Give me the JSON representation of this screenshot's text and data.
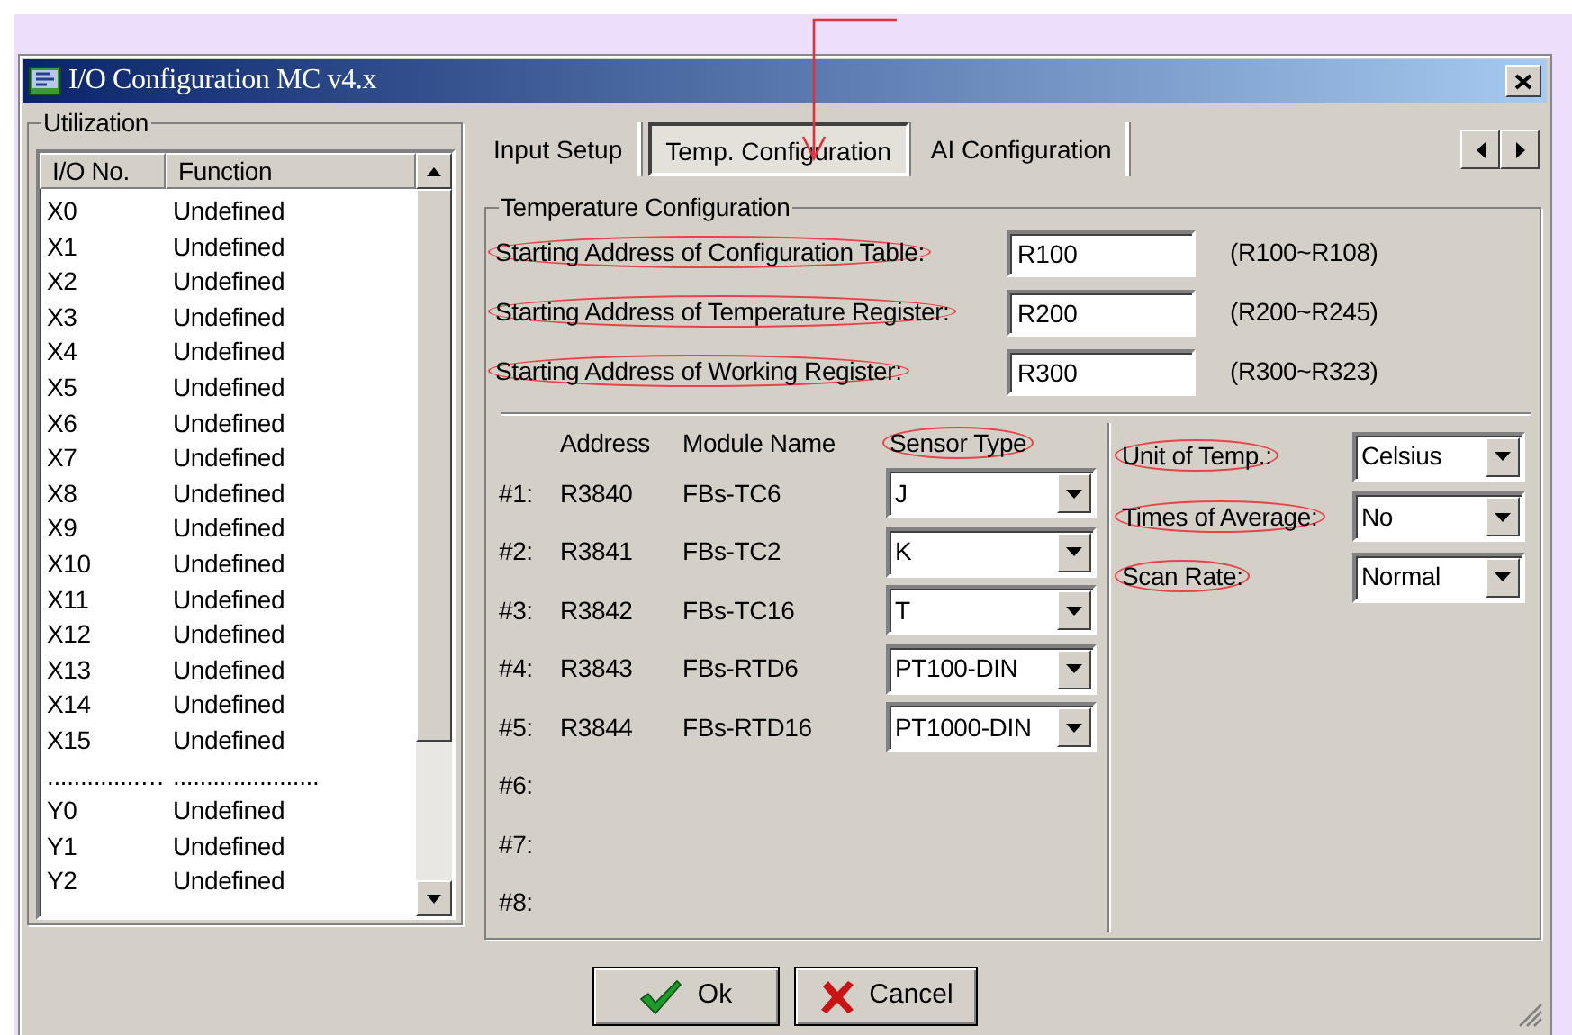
{
  "window": {
    "title": "I/O Configuration MC v4.x"
  },
  "utilization": {
    "title": "Utilization",
    "columns": [
      "I/O No.",
      "Function"
    ],
    "rows": [
      {
        "io": "X0",
        "function": "Undefined"
      },
      {
        "io": "X1",
        "function": "Undefined"
      },
      {
        "io": "X2",
        "function": "Undefined"
      },
      {
        "io": "X3",
        "function": "Undefined"
      },
      {
        "io": "X4",
        "function": "Undefined"
      },
      {
        "io": "X5",
        "function": "Undefined"
      },
      {
        "io": "X6",
        "function": "Undefined"
      },
      {
        "io": "X7",
        "function": "Undefined"
      },
      {
        "io": "X8",
        "function": "Undefined"
      },
      {
        "io": "X9",
        "function": "Undefined"
      },
      {
        "io": "X10",
        "function": "Undefined"
      },
      {
        "io": "X11",
        "function": "Undefined"
      },
      {
        "io": "X12",
        "function": "Undefined"
      },
      {
        "io": "X13",
        "function": "Undefined"
      },
      {
        "io": "X14",
        "function": "Undefined"
      },
      {
        "io": "X15",
        "function": "Undefined"
      },
      {
        "io": "..............…",
        "function": "......................"
      },
      {
        "io": "Y0",
        "function": "Undefined"
      },
      {
        "io": "Y1",
        "function": "Undefined"
      },
      {
        "io": "Y2",
        "function": "Undefined"
      }
    ]
  },
  "tabs": [
    {
      "label": "Input Setup",
      "selected": false
    },
    {
      "label": "Temp. Configuration",
      "selected": true
    },
    {
      "label": "AI Configuration",
      "selected": false
    }
  ],
  "temperature_configuration": {
    "title": "Temperature Configuration",
    "addresses": [
      {
        "label": "Starting Address of Configuration Table:",
        "highlighted": true,
        "value": "R100",
        "range": "(R100~R108)"
      },
      {
        "label": "Starting Address of Temperature Register:",
        "highlighted": true,
        "value": "R200",
        "range": "(R200~R245)"
      },
      {
        "label": "Starting Address of Working Register:",
        "highlighted": true,
        "value": "R300",
        "range": "(R300~R323)"
      }
    ],
    "module_columns": [
      {
        "label": "Address",
        "highlighted": false
      },
      {
        "label": "Module Name",
        "highlighted": false
      },
      {
        "label": "Sensor Type",
        "highlighted": true
      }
    ],
    "modules": [
      {
        "number": "#1:",
        "address": "R3840",
        "module": "FBs-TC6",
        "sensor_type": "J"
      },
      {
        "number": "#2:",
        "address": "R3841",
        "module": "FBs-TC2",
        "sensor_type": "K"
      },
      {
        "number": "#3:",
        "address": "R3842",
        "module": "FBs-TC16",
        "sensor_type": "T"
      },
      {
        "number": "#4:",
        "address": "R3843",
        "module": "FBs-RTD6",
        "sensor_type": "PT100-DIN"
      },
      {
        "number": "#5:",
        "address": "R3844",
        "module": "FBs-RTD16",
        "sensor_type": "PT1000-DIN"
      },
      {
        "number": "#6:"
      },
      {
        "number": "#7:"
      },
      {
        "number": "#8:"
      }
    ],
    "settings": [
      {
        "label": "Unit of Temp.:",
        "highlighted": true,
        "value": "Celsius"
      },
      {
        "label": "Times of Average:",
        "highlighted": true,
        "value": "No"
      },
      {
        "label": "Scan Rate:",
        "highlighted": true,
        "value": "Normal"
      }
    ]
  },
  "buttons": [
    {
      "label": "Ok",
      "kind": "ok"
    },
    {
      "label": "Cancel",
      "kind": "cancel"
    }
  ]
}
